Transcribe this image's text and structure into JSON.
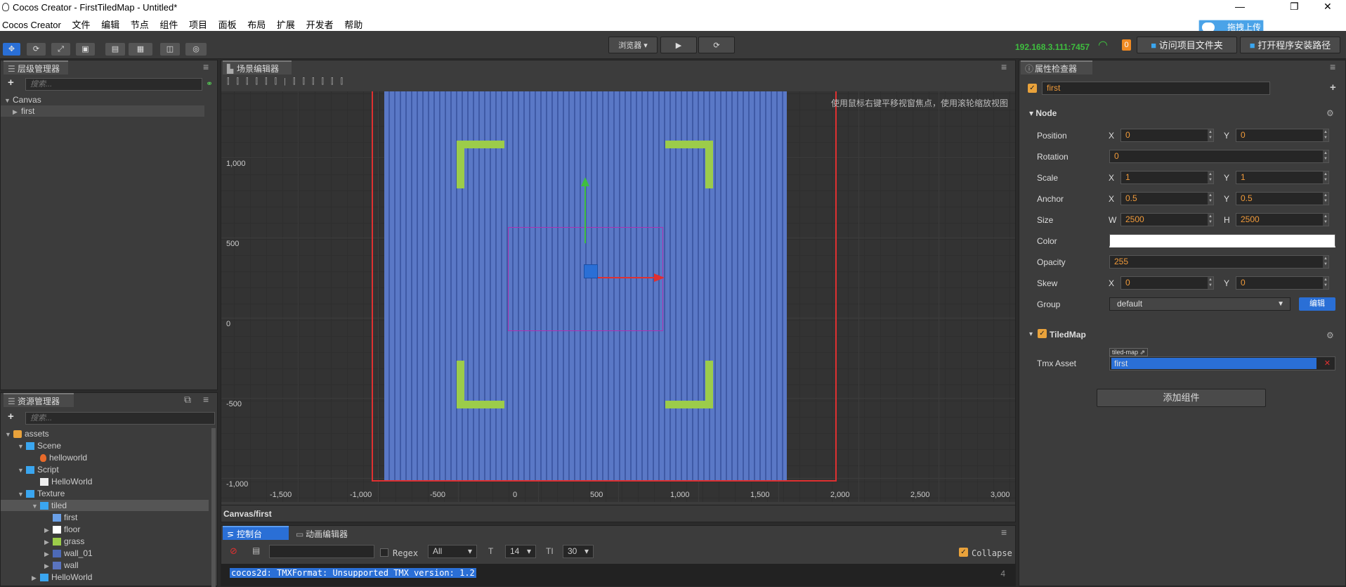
{
  "window": {
    "title": "Cocos Creator - FirstTiledMap - Untitled*",
    "minimize": "—",
    "maximize": "❐",
    "close": "✕"
  },
  "menu": [
    "Cocos Creator",
    "文件",
    "编辑",
    "节点",
    "组件",
    "项目",
    "面板",
    "布局",
    "扩展",
    "开发者",
    "帮助"
  ],
  "upload_badge": "拖拽上传",
  "toolbar": {
    "preview_select": "浏览器",
    "ip": "192.168.3.111:7457",
    "count_badge": "0",
    "open_project_btn": "访问项目文件夹",
    "open_install_btn": "打开程序安装路径"
  },
  "hierarchy": {
    "tab": "层级管理器",
    "search_placeholder": "搜索...",
    "nodes": [
      {
        "label": "Canvas"
      },
      {
        "label": "first"
      }
    ]
  },
  "assets": {
    "tab": "资源管理器",
    "search_placeholder": "搜索...",
    "items": [
      "assets",
      "Scene",
      "helloworld",
      "Script",
      "HelloWorld",
      "Texture",
      "tiled",
      "first",
      "floor",
      "grass",
      "wall_01",
      "wall",
      "HelloWorld"
    ]
  },
  "scene": {
    "tab": "场景编辑器",
    "hint": "使用鼠标右键平移视窗焦点，使用滚轮缩放视图",
    "y_ticks": [
      "1,000",
      "500",
      "0",
      "-500",
      "-1,000"
    ],
    "x_ticks": [
      "-1,500",
      "-1,000",
      "-500",
      "0",
      "500",
      "1,000",
      "1,500",
      "2,000",
      "2,500",
      "3,000"
    ],
    "breadcrumb": "Canvas/first"
  },
  "console": {
    "tab_console": "控制台",
    "tab_anim": "动画编辑器",
    "regex_label": "Regex",
    "level": "All",
    "font_size": "14",
    "line_height": "30",
    "collapse_label": "Collapse",
    "log_message": "cocos2d: TMXFormat: Unsupported TMX version: 1.2",
    "log_count": "4"
  },
  "inspector": {
    "tab": "属性检查器",
    "node_name": "first",
    "node_section": "Node",
    "props": {
      "position": {
        "label": "Position",
        "x": "0",
        "y": "0"
      },
      "rotation": {
        "label": "Rotation",
        "value": "0"
      },
      "scale": {
        "label": "Scale",
        "x": "1",
        "y": "1"
      },
      "anchor": {
        "label": "Anchor",
        "x": "0.5",
        "y": "0.5"
      },
      "size": {
        "label": "Size",
        "w": "2500",
        "h": "2500"
      },
      "color": {
        "label": "Color",
        "value": "#ffffff"
      },
      "opacity": {
        "label": "Opacity",
        "value": "255"
      },
      "skew": {
        "label": "Skew",
        "x": "0",
        "y": "0"
      },
      "group": {
        "label": "Group",
        "value": "default",
        "edit": "编辑"
      }
    },
    "axis": {
      "x": "X",
      "y": "Y",
      "w": "W",
      "h": "H"
    },
    "tiledmap_section": "TiledMap",
    "tmx_label": "Tmx Asset",
    "tmx_tag": "tiled-map",
    "tmx_value": "first",
    "add_component": "添加组件"
  },
  "colors": {
    "accent": "#2a6fd6",
    "map_blue": "#4d6ab8",
    "grass": "#9ccc4a",
    "selection_red": "#e03030",
    "ip_green": "#3fbf3f",
    "orange": "#f09a3a"
  }
}
